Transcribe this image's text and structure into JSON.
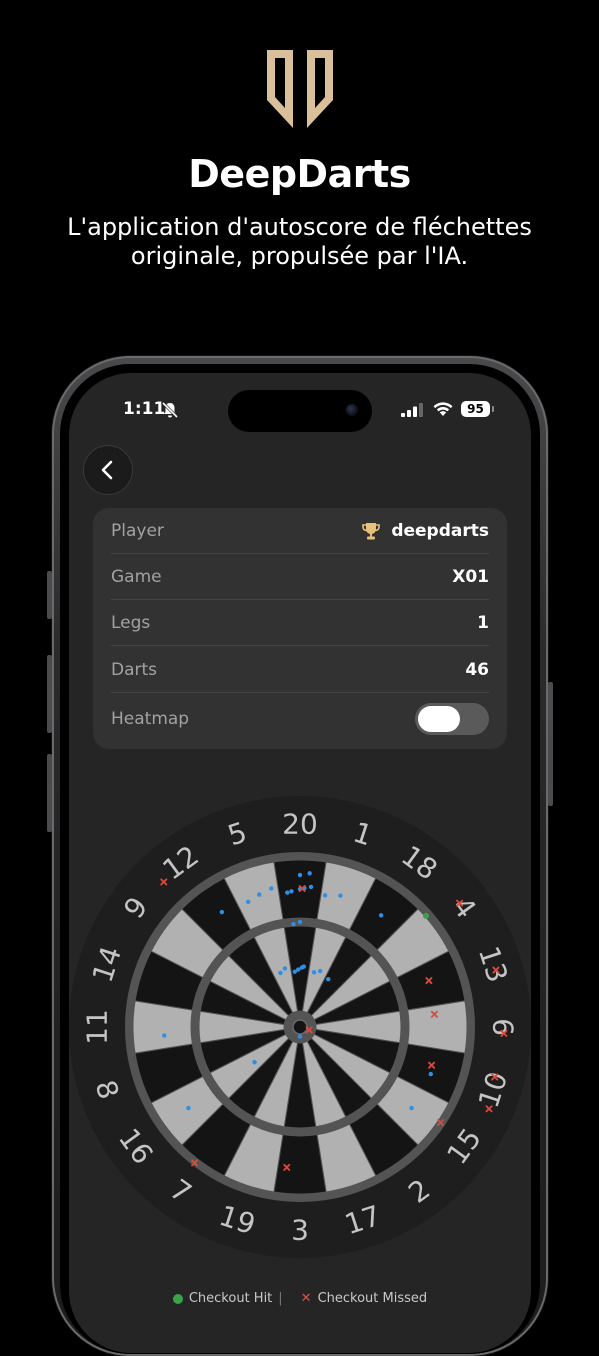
{
  "promo": {
    "app_name": "DeepDarts",
    "tagline": "L'application d'autoscore de fléchettes originale, propulsée par l'IA."
  },
  "status_bar": {
    "time": "1:11",
    "battery": "95",
    "icons": [
      "bell-off-icon",
      "signal-icon",
      "wifi-icon",
      "battery-icon"
    ]
  },
  "nav": {
    "back_icon": "chevron-left-icon"
  },
  "info": {
    "player": {
      "label": "Player",
      "value": "deepdarts",
      "icon": "trophy-icon"
    },
    "game": {
      "label": "Game",
      "value": "X01"
    },
    "legs": {
      "label": "Legs",
      "value": "1"
    },
    "darts": {
      "label": "Darts",
      "value": "46"
    },
    "heatmap": {
      "label": "Heatmap",
      "enabled": false
    }
  },
  "dartboard": {
    "numbers": [
      20,
      1,
      18,
      4,
      13,
      6,
      10,
      15,
      2,
      17,
      3,
      19,
      7,
      16,
      8,
      11,
      14,
      9,
      12,
      5
    ],
    "colors": {
      "light_segment": "#b1b1b1",
      "dark_segment": "#141414",
      "ring": "#545454",
      "outer_ring": "#1e1e1e",
      "number_text": "#c4c4c4",
      "hit_blue": "#2f8ee6",
      "miss_red": "#dd4a3a",
      "hit_green": "#3aa14a"
    },
    "hits_blue": [
      {
        "number": 20,
        "zone": "single",
        "t": 0.3
      },
      {
        "number": 20,
        "zone": "single",
        "t": 0.2
      },
      {
        "number": 20,
        "zone": "single",
        "t": 0.5
      },
      {
        "number": 20,
        "zone": "single",
        "t": 0.75
      },
      {
        "number": 20,
        "zone": "single",
        "t": 0.6
      },
      {
        "number": 20,
        "zone": "treble",
        "t": 0.5
      },
      {
        "number": 20,
        "zone": "treble",
        "t": 0.3
      },
      {
        "number": 20,
        "zone": "inner",
        "t": 0.4
      },
      {
        "number": 20,
        "zone": "inner",
        "t": 0.6
      },
      {
        "number": 20,
        "zone": "inner",
        "t": 0.2
      },
      {
        "number": 20,
        "zone": "inner",
        "t": 0.7
      },
      {
        "number": 1,
        "zone": "inner",
        "t": 0.3
      },
      {
        "number": 1,
        "zone": "inner",
        "t": 0.6
      },
      {
        "number": 1,
        "zone": "single",
        "t": 0.1
      },
      {
        "number": 1,
        "zone": "single",
        "t": 0.45
      },
      {
        "number": 5,
        "zone": "inner",
        "t": 0.7
      },
      {
        "number": 5,
        "zone": "inner",
        "t": 0.4
      },
      {
        "number": 5,
        "zone": "single",
        "t": 0.85
      },
      {
        "number": 5,
        "zone": "single",
        "t": 0.55
      },
      {
        "number": 5,
        "zone": "single",
        "t": 0.25
      },
      {
        "number": 12,
        "zone": "single",
        "t": 0.6
      },
      {
        "number": 18,
        "zone": "single",
        "t": 0.5
      },
      {
        "number": 18,
        "zone": "inner",
        "t": 0.2
      },
      {
        "number": 11,
        "zone": "single",
        "t": 0.3
      },
      {
        "number": 16,
        "zone": "single",
        "t": 0.5
      },
      {
        "number": 16,
        "zone": "inner",
        "t": 0.4
      },
      {
        "number": 15,
        "zone": "single",
        "t": 0.5
      },
      {
        "number": 10,
        "zone": "single",
        "t": 0.6
      },
      {
        "number": 20,
        "zone": "outer",
        "t": 0.5
      },
      {
        "number": 20,
        "zone": "outer",
        "t": 0.7
      },
      {
        "number": 3,
        "zone": "bull",
        "t": 0.5
      }
    ],
    "misses_red": [
      {
        "number": 20,
        "zone": "single",
        "t": 0.55
      },
      {
        "number": 12,
        "zone": "offboard",
        "t": 0.1
      },
      {
        "number": 4,
        "zone": "offboard",
        "t": 0.4
      },
      {
        "number": 13,
        "zone": "offboard",
        "t": 0.6
      },
      {
        "number": 6,
        "zone": "offboard",
        "t": 0.6
      },
      {
        "number": 10,
        "zone": "offboard",
        "t": 0.3
      },
      {
        "number": 10,
        "zone": "offboard",
        "t": 0.8
      },
      {
        "number": 13,
        "zone": "single",
        "t": 0.4
      },
      {
        "number": 6,
        "zone": "single",
        "t": 0.2
      },
      {
        "number": 10,
        "zone": "single",
        "t": 0.4
      },
      {
        "number": 15,
        "zone": "double",
        "t": 0.4
      },
      {
        "number": 3,
        "zone": "single",
        "t": 0.8
      },
      {
        "number": 7,
        "zone": "double",
        "t": 0.6
      },
      {
        "number": 10,
        "zone": "bull",
        "t": 0.5
      }
    ],
    "hits_green": [
      {
        "number": 4,
        "zone": "double",
        "t": 0.2
      }
    ]
  },
  "legend": {
    "hit_label": "Checkout Hit",
    "miss_label": "Checkout Missed"
  }
}
